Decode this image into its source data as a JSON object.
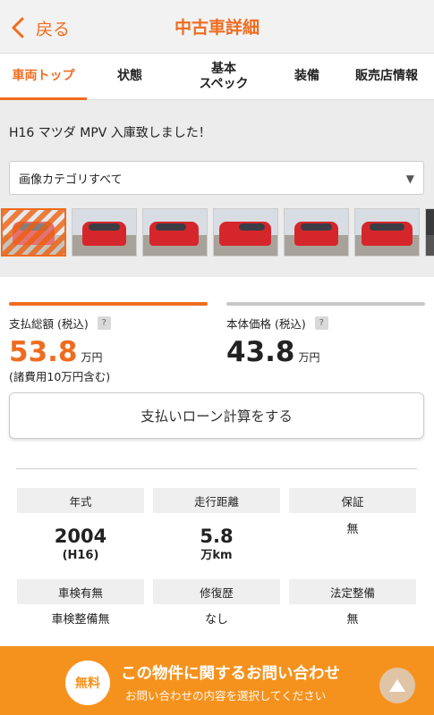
{
  "header": {
    "back_label": "戻る",
    "title": "中古車詳細"
  },
  "tabs": [
    {
      "label": "車両トップ",
      "active": true
    },
    {
      "label": "状態",
      "active": false
    },
    {
      "label": "基本\nスペック",
      "active": false
    },
    {
      "label": "装備",
      "active": false
    },
    {
      "label": "販売店情報",
      "active": false
    }
  ],
  "headline": "H16 マツダ MPV 入庫致しました！",
  "image_category": {
    "selected": "画像カテゴリすべて"
  },
  "prices": {
    "total_label": "支払総額 (税込)",
    "total_value": "53.8",
    "total_unit": "万円",
    "total_note": "(諸費用10万円含む)",
    "body_label": "本体価格 (税込)",
    "body_value": "43.8",
    "body_unit": "万円",
    "help_mark": "?"
  },
  "loan_button": "支払いローン計算をする",
  "specs": [
    {
      "label": "年式",
      "value": "2004",
      "sub": "(H16)"
    },
    {
      "label": "走行距離",
      "value": "5.8",
      "sub": "万km"
    },
    {
      "label": "保証",
      "plain": "無"
    },
    {
      "label": "車検有無",
      "plain": "車検整備無"
    },
    {
      "label": "修復歴",
      "plain": "なし"
    },
    {
      "label": "法定整備",
      "plain": "無"
    }
  ],
  "cta": {
    "badge": "無料",
    "main": "この物件に関するお問い合わせ",
    "sub": "お問い合わせの内容を選択してください"
  },
  "colors": {
    "accent": "#ef6c1f",
    "cta": "#f5921e",
    "car": "#d5272b"
  }
}
